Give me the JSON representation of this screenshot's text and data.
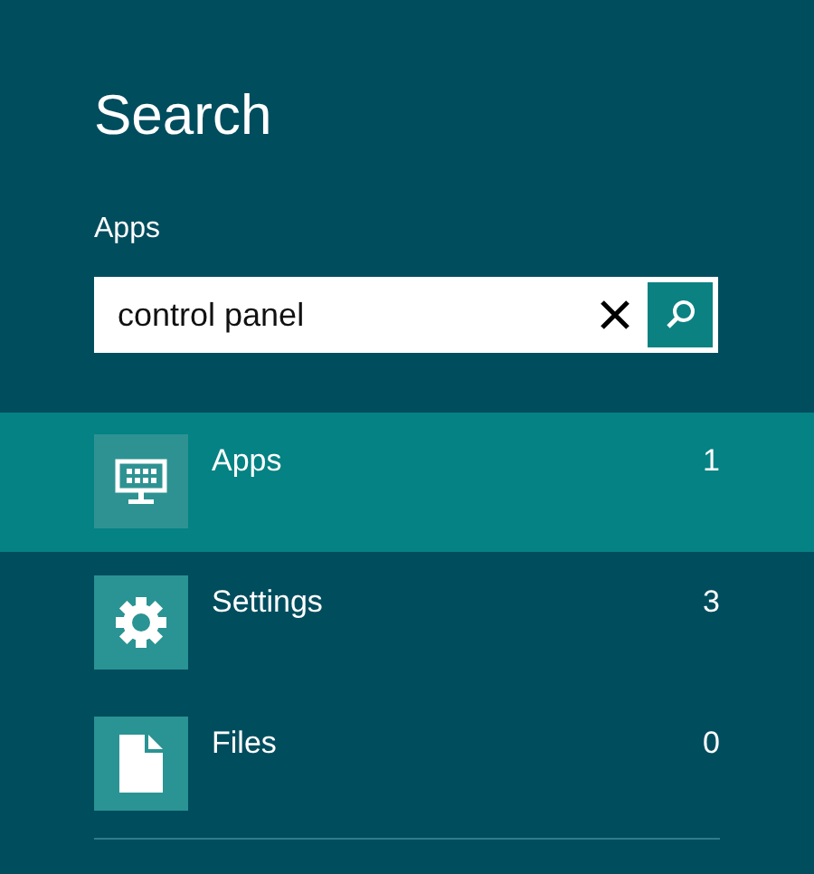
{
  "title": "Search",
  "scope": "Apps",
  "search": {
    "value": "control panel"
  },
  "results": [
    {
      "kind": "apps",
      "label": "Apps",
      "count": "1",
      "selected": true
    },
    {
      "kind": "settings",
      "label": "Settings",
      "count": "3",
      "selected": false
    },
    {
      "kind": "files",
      "label": "Files",
      "count": "0",
      "selected": false
    }
  ]
}
